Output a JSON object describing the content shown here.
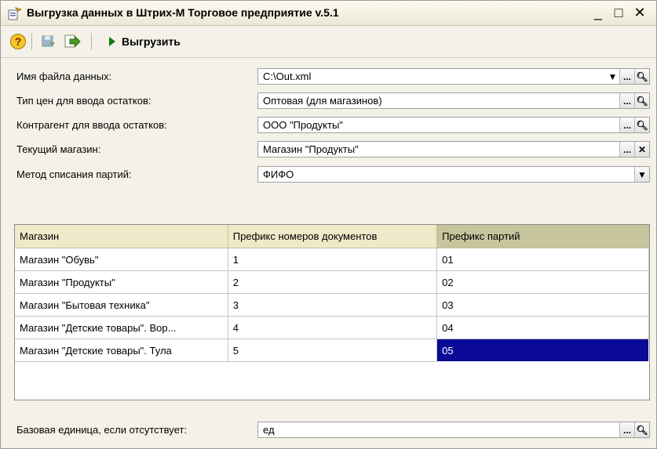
{
  "window": {
    "title": "Выгрузка данных в Штрих-М Торговое предприятие v.5.1",
    "controls": [
      "_",
      "□",
      "✕"
    ]
  },
  "toolbar": {
    "export_label": "Выгрузить"
  },
  "form": {
    "file_label": "Имя файла данных:",
    "file_value": "C:\\Out.xml",
    "price_type_label": "Тип цен для ввода остатков:",
    "price_type_value": "Оптовая (для магазинов)",
    "counterparty_label": "Контрагент для ввода остатков:",
    "counterparty_value": "ООО \"Продукты\"",
    "store_label": "Текущий магазин:",
    "store_value": "Магазин \"Продукты\"",
    "writeoff_label": "Метод списания партий:",
    "writeoff_value": "ФИФО",
    "base_unit_label": "Базовая единица, если отсутствует:",
    "base_unit_value": "ед"
  },
  "table": {
    "headers": [
      "Магазин",
      "Префикс номеров документов",
      "Префикс партий"
    ],
    "rows": [
      [
        "Магазин \"Обувь\"",
        "1",
        "01"
      ],
      [
        "Магазин \"Продукты\"",
        "2",
        "02"
      ],
      [
        "Магазин \"Бытовая техника\"",
        "3",
        "03"
      ],
      [
        "Магазин \"Детские товары\". Вор...",
        "4",
        "04"
      ],
      [
        "Магазин \"Детские товары\". Тула",
        "5",
        "05"
      ]
    ]
  },
  "colors": {
    "selected_cell": "#0a0a96",
    "header_bg": "#efe9c9",
    "window_bg": "#f4f2e8"
  },
  "icons": [
    "form-icon",
    "help-icon",
    "disk-icon",
    "export-icon",
    "play-icon",
    "dropdown-icon",
    "ellipsis-icon",
    "search-icon",
    "clear-icon"
  ]
}
